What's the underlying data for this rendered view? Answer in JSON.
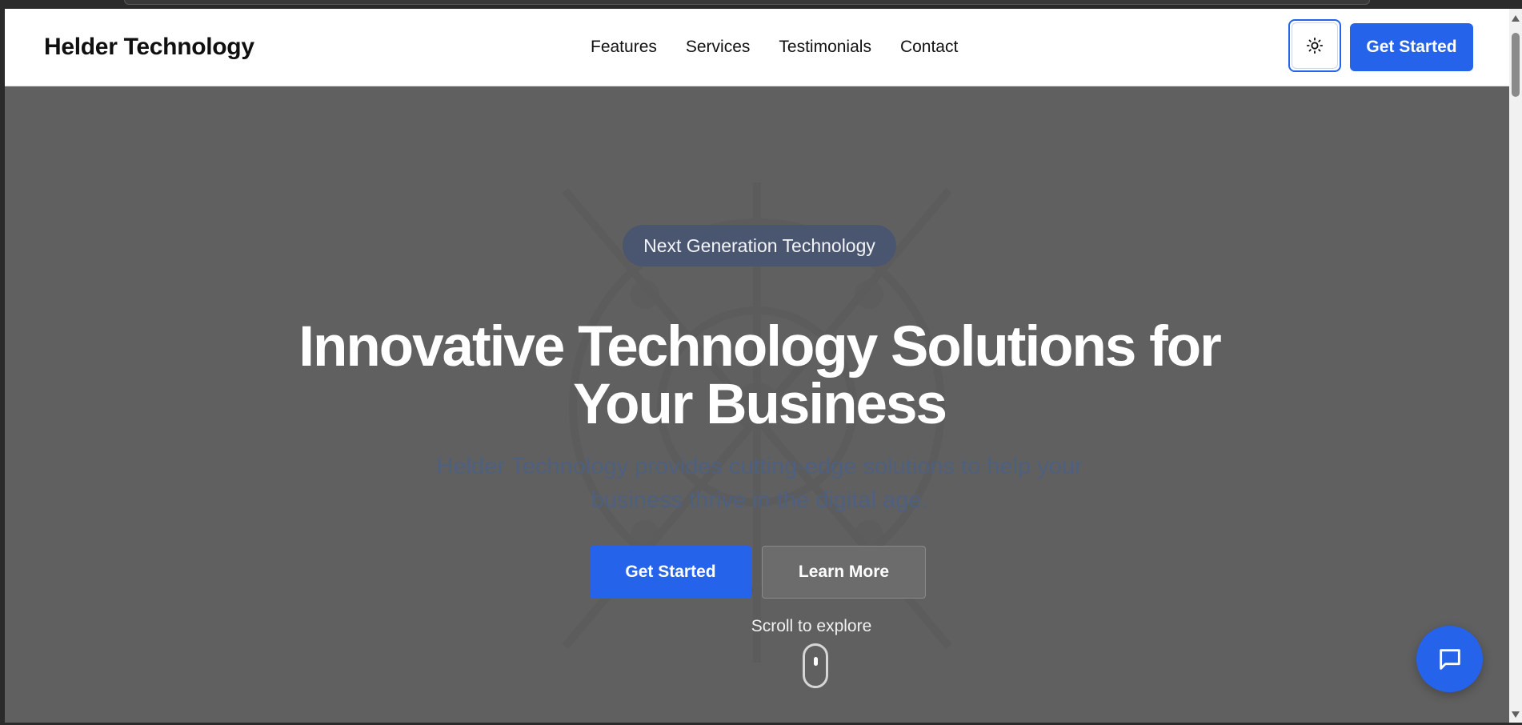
{
  "header": {
    "brand": "Helder Technology",
    "nav": [
      "Features",
      "Services",
      "Testimonials",
      "Contact"
    ],
    "theme_toggle_icon": "sun-icon",
    "cta_label": "Get Started"
  },
  "hero": {
    "badge": "Next Generation Technology",
    "title_line1": "Innovative Technology Solutions for",
    "title_line2": "Your Business",
    "subtitle_line1": "Helder Technology provides cutting-edge solutions to help your",
    "subtitle_line2": "business thrive in the digital age.",
    "primary_button": "Get Started",
    "secondary_button": "Learn More",
    "scroll_hint": "Scroll to explore"
  },
  "chat": {
    "icon": "chat-bubble-icon"
  },
  "colors": {
    "accent": "#2563eb",
    "hero_overlay": "#606060",
    "badge_bg": "#4a5670",
    "subtitle_text": "#4e6080"
  }
}
